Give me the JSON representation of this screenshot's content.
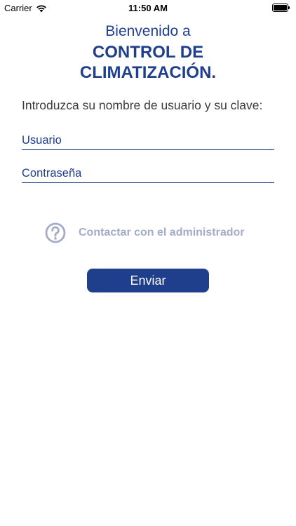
{
  "status_bar": {
    "carrier": "Carrier",
    "time": "11:50 AM",
    "icons": [
      "wifi-icon",
      "battery-icon"
    ]
  },
  "header": {
    "welcome": "Bienvenido a",
    "title_line1": "CONTROL DE",
    "title_line2": "CLIMATIZACIÓN."
  },
  "form": {
    "instructions": "Introduzca su nombre de usuario y su clave:",
    "username": {
      "placeholder": "Usuario",
      "value": ""
    },
    "password": {
      "placeholder": "Contraseña",
      "value": ""
    }
  },
  "contact": {
    "label": "Contactar con el administrador",
    "icon": "help-circle-icon"
  },
  "submit": {
    "label": "Enviar"
  },
  "colors": {
    "brand": "#1f3f8d",
    "muted": "#a3abc8",
    "text": "#3b3b3b",
    "background": "#ffffff"
  }
}
